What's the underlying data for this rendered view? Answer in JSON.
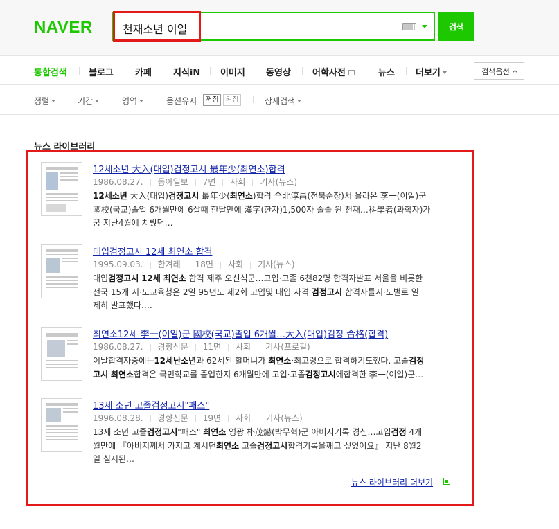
{
  "header": {
    "logo": "NAVER",
    "search_query": "천재소년 이일",
    "search_button": "검색",
    "keyboard_icon": "keyboard-icon",
    "dropdown_icon": "chevron-down-icon"
  },
  "tabs": {
    "items": [
      {
        "label": "통합검색",
        "active": true
      },
      {
        "label": "블로그"
      },
      {
        "label": "카페"
      },
      {
        "label": "지식iN"
      },
      {
        "label": "이미지"
      },
      {
        "label": "동영상"
      },
      {
        "label": "어학사전"
      },
      {
        "label": "뉴스"
      },
      {
        "label": "더보기"
      }
    ],
    "options_button": "검색옵션"
  },
  "filters": {
    "sort": "정렬",
    "period": "기간",
    "area": "영역",
    "keep_options": "옵션유지",
    "toggle_off": "꺼짐",
    "toggle_on": "켜짐",
    "detailed": "상세검색"
  },
  "section": {
    "title": "뉴스 라이브러리",
    "more_link": "뉴스 라이브러리 더보기"
  },
  "results": [
    {
      "title": "12세소년 大入(대입)검정고시 最年少(최연소)합격",
      "date": "1986.08.27.",
      "paper": "동아일보",
      "page": "7면",
      "section": "사회",
      "type": "기사(뉴스)",
      "desc_line1": "12세소년 大入(대입)검정고시 最年少(최연소)합격 全北淳昌(전북순창)서 올라온 李一(이일)군",
      "desc_line2": "國校(국교)졸업 6개월만에 6살때 한달만에 漢字(한자)1,500자 줄줄 윈 천재…科學者(과학자)가",
      "desc_line3": "꿈 지난4월에 치뤘던…"
    },
    {
      "title": "대입검정고시 12세 최연소 합격",
      "date": "1995.09.03.",
      "paper": "한겨레",
      "page": "18면",
      "section": "사회",
      "type": "기사(뉴스)",
      "desc_line1": "대입검정고시 12세 최연소 합격 제주 오신석군…고입·고졸 6천82명 합격자발표 서울을 비롯한",
      "desc_line2": "전국 15개 시·도교육청은 2일 95년도 제2회 고입및 대입 자격 검정고시 합격자를시·도별로 일",
      "desc_line3": "제히 발표했다.…"
    },
    {
      "title": "최연소12세 李一(이일)군 國校(국교)졸업 6개월…大入(대입)검정 合格(합격)",
      "date": "1986.08.27.",
      "paper": "경향신문",
      "page": "11면",
      "section": "사회",
      "type": "기사(프로필)",
      "desc_line1": "이날합격자중에는12세난소년과 62세된 할머니가 최연소·최고령으로 합격하기도했다. 고졸검정",
      "desc_line2": "고시 최연소합격은 국민학교를 졸업한지 6개월만에 고입·고졸검정고시에합격한 李一(이일)군…",
      "desc_line3": ""
    },
    {
      "title": "13세 소년 고졸검정고시\"패스\"",
      "date": "1996.08.28.",
      "paper": "경향신문",
      "page": "19면",
      "section": "사회",
      "type": "기사(뉴스)",
      "desc_line1": "13세 소년 고졸검정고시\"패스\" 최연소 영광 朴茂爀(박무혁)군 아버지기록 경신…고입검정 4개",
      "desc_line2": "월만에 『아버지께서 가지고 계시던최연소 고졸검정고시합격기록을깨고 싶었어요』 지난 8월2",
      "desc_line3": "일 실시된…"
    }
  ]
}
